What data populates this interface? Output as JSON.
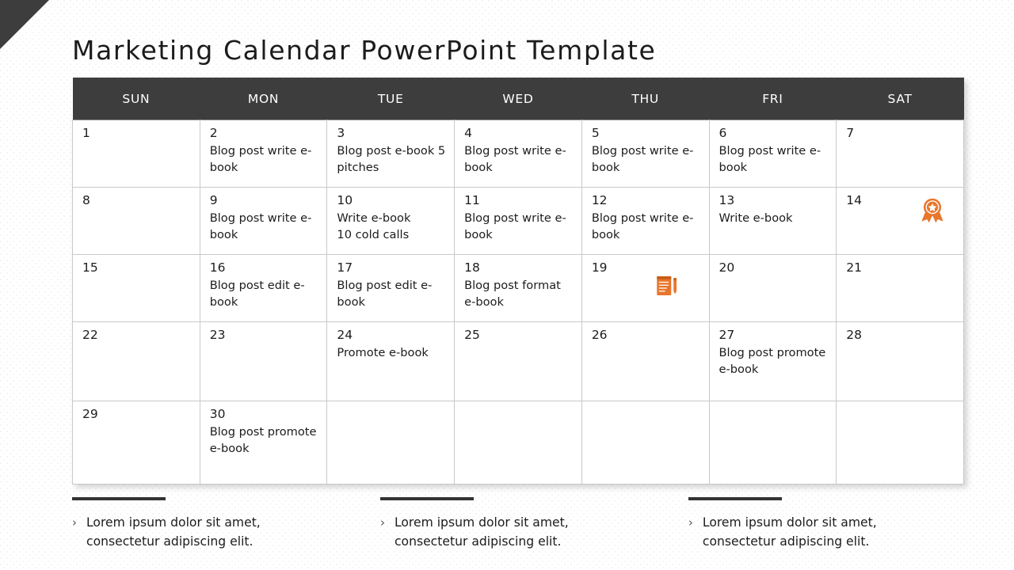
{
  "title": "Marketing Calendar PowerPoint Template",
  "colors": {
    "header_bar": "#3d3d3d",
    "corner_wedge": "#3d3d3d",
    "accent_orange": "#E8762C",
    "blank_cell": "#efefef",
    "text": "#1c1c1c",
    "grid_line": "#c9c9c9"
  },
  "calendar": {
    "weekday_headers": [
      "SUN",
      "MON",
      "TUE",
      "WED",
      "THU",
      "FRI",
      "SAT"
    ],
    "weeks": [
      {
        "days": [
          {
            "num": "1",
            "tasks": []
          },
          {
            "num": "2",
            "tasks": [
              "Blog post write e-book"
            ]
          },
          {
            "num": "3",
            "tasks": [
              "Blog post e-book 5 pitches"
            ]
          },
          {
            "num": "4",
            "tasks": [
              "Blog post write e-book"
            ]
          },
          {
            "num": "5",
            "tasks": [
              "Blog post write e-book"
            ]
          },
          {
            "num": "6",
            "tasks": [
              "Blog post write e-book"
            ]
          },
          {
            "num": "7",
            "tasks": []
          }
        ]
      },
      {
        "days": [
          {
            "num": "8",
            "tasks": []
          },
          {
            "num": "9",
            "tasks": [
              "Blog post write e-book"
            ]
          },
          {
            "num": "10",
            "tasks": [
              "Write e-book",
              "10 cold calls"
            ]
          },
          {
            "num": "11",
            "tasks": [
              "Blog post write e-book"
            ]
          },
          {
            "num": "12",
            "tasks": [
              "Blog post write e-book"
            ]
          },
          {
            "num": "13",
            "tasks": [
              "Write e-book"
            ]
          },
          {
            "num": "14",
            "tasks": [],
            "icon": "award-badge-icon"
          }
        ]
      },
      {
        "days": [
          {
            "num": "15",
            "tasks": []
          },
          {
            "num": "16",
            "tasks": [
              "Blog post edit e-book"
            ]
          },
          {
            "num": "17",
            "tasks": [
              "Blog post edit e-book"
            ]
          },
          {
            "num": "18",
            "tasks": [
              "Blog post format e-book"
            ]
          },
          {
            "num": "19",
            "tasks": [],
            "icon": "document-pen-icon"
          },
          {
            "num": "20",
            "tasks": []
          },
          {
            "num": "21",
            "tasks": []
          }
        ]
      },
      {
        "days": [
          {
            "num": "22",
            "tasks": []
          },
          {
            "num": "23",
            "tasks": []
          },
          {
            "num": "24",
            "tasks": [
              "Promote e-book"
            ]
          },
          {
            "num": "25",
            "tasks": []
          },
          {
            "num": "26",
            "tasks": []
          },
          {
            "num": "27",
            "tasks": [
              "Blog post promote e-book"
            ]
          },
          {
            "num": "28",
            "tasks": []
          }
        ]
      },
      {
        "days": [
          {
            "num": "29",
            "tasks": []
          },
          {
            "num": "30",
            "tasks": [
              "Blog post promote e-book"
            ]
          },
          {
            "num": "",
            "tasks": [],
            "blank": true
          },
          {
            "num": "",
            "tasks": [],
            "blank": true
          },
          {
            "num": "",
            "tasks": [],
            "blank": true
          },
          {
            "num": "",
            "tasks": [],
            "blank": true
          },
          {
            "num": "",
            "tasks": [],
            "blank": true
          }
        ]
      }
    ]
  },
  "captions": [
    {
      "bullet": "›",
      "line1": "Lorem ipsum dolor sit amet,",
      "line2": "consectetur adipiscing elit."
    },
    {
      "bullet": "›",
      "line1": "Lorem ipsum dolor sit amet,",
      "line2": "consectetur adipiscing elit."
    },
    {
      "bullet": "›",
      "line1": "Lorem ipsum dolor sit amet,",
      "line2": "consectetur adipiscing elit."
    }
  ]
}
